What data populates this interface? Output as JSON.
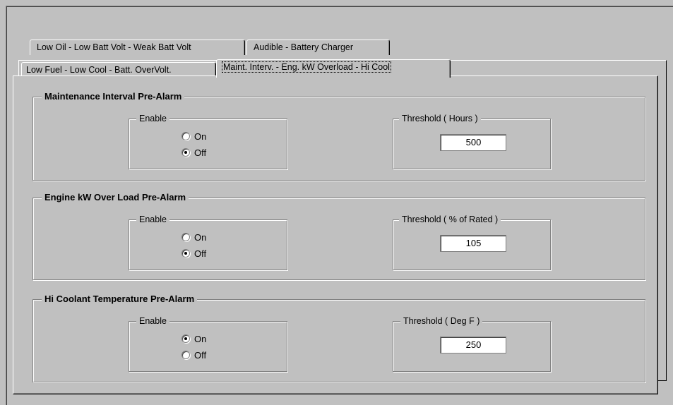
{
  "tabs_row_back": [
    {
      "label": "Low Oil - Low Batt  Volt - Weak Batt Volt"
    },
    {
      "label": "Audible - Battery Charger"
    }
  ],
  "tabs_row_front": [
    {
      "label": "Low Fuel - Low Cool - Batt. OverVolt."
    },
    {
      "label": "Maint. Interv. - Eng. kW Overload - Hi Cool"
    }
  ],
  "groups": [
    {
      "title": "Maintenance Interval Pre-Alarm",
      "enable_label": "Enable",
      "on_label": "On",
      "off_label": "Off",
      "selected": "Off",
      "threshold_label": "Threshold ( Hours )",
      "threshold_value": "500"
    },
    {
      "title": "Engine kW Over Load Pre-Alarm",
      "enable_label": "Enable",
      "on_label": "On",
      "off_label": "Off",
      "selected": "Off",
      "threshold_label": "Threshold ( % of Rated )",
      "threshold_value": "105"
    },
    {
      "title": "Hi Coolant Temperature Pre-Alarm",
      "enable_label": "Enable",
      "on_label": "On",
      "off_label": "Off",
      "selected": "On",
      "threshold_label": "Threshold ( Deg F )",
      "threshold_value": "250"
    }
  ]
}
